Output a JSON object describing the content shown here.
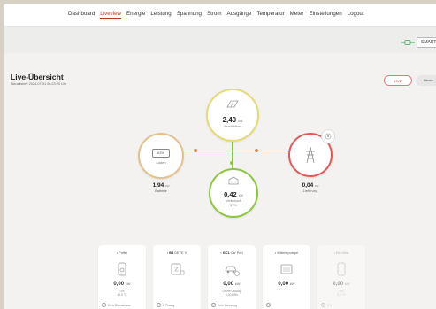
{
  "nav": [
    "Dashboard",
    "Liveview",
    "Energie",
    "Leistung",
    "Spannung",
    "Strom",
    "Ausgänge",
    "Temperatur",
    "Meter",
    "Einstellungen",
    "Logout"
  ],
  "nav_active_index": 1,
  "smart_button": "SMART",
  "page": {
    "title": "Live-Übersicht",
    "updated": "Aktualisiert: 2024-07-01 08:23:20 Uhr"
  },
  "range": {
    "live": "LIVE",
    "heute": "Heute"
  },
  "production": {
    "value": "2,40",
    "unit": "kW",
    "label": "Produktion"
  },
  "battery": {
    "percent": "63%",
    "label": "Laden",
    "value": "1,94",
    "unit": "kW",
    "sub": "Batterie"
  },
  "consumption": {
    "value": "0,42",
    "unit": "kW",
    "label": "Verbrauch",
    "sub": "17%"
  },
  "grid": {
    "value": "0,04",
    "unit": "kW",
    "sub": "Lieferung"
  },
  "cards": [
    {
      "title": "Puffer",
      "prefix": "",
      "value": "0,00",
      "unit": "kW",
      "sub1": "0%",
      "sub2": "48,9 °C",
      "foot": "Kein Überschuss",
      "dim": false
    },
    {
      "title": "DEYE V",
      "prefix": "B4",
      "value": "",
      "unit": "",
      "sub1": "",
      "sub2": "",
      "foot": "1 Phasig",
      "dim": false
    },
    {
      "title": "Car Port",
      "prefix": "GC1",
      "value": "0,00",
      "unit": "kW",
      "sub1": "Letzte Ladung",
      "sub2": "0,00 kWh",
      "foot": "Kein Fahrzeug",
      "dim": false
    },
    {
      "title": "Wärmepumpe",
      "prefix": "",
      "value": "0,00",
      "unit": "kW",
      "sub1": "",
      "sub2": "",
      "foot": "",
      "dim": false
    },
    {
      "title": "Ein-Heiz",
      "prefix": "",
      "value": "0,00",
      "unit": "kW",
      "sub1": "0%",
      "sub2": "0,0 °C",
      "foot": "0 V",
      "dim": true
    }
  ],
  "colors": {
    "accent": "#c0392b",
    "flow_green": "#8cc63f",
    "flow_orange": "#e8873a",
    "production_ring": "#e6d97a",
    "battery_ring": "#e6c08a",
    "grid_ring": "#e05a5a",
    "consumption_ring": "#8cc63f"
  }
}
